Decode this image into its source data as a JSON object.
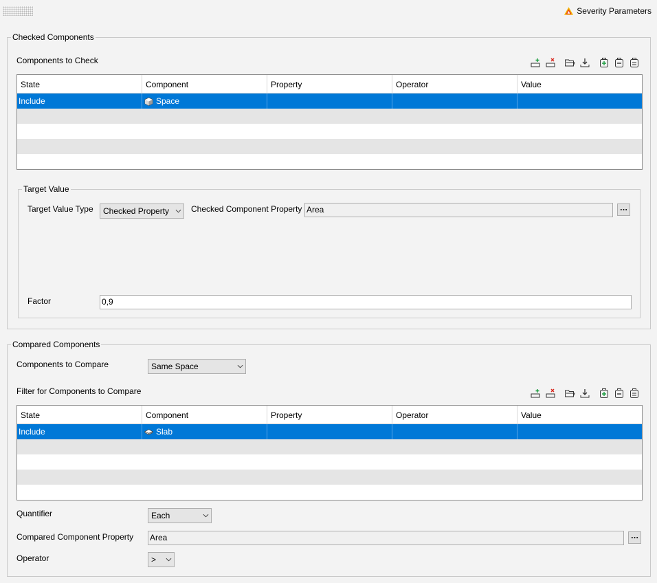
{
  "header": {
    "severity_label": "Severity Parameters",
    "severity_icon": "warning-triangle-icon",
    "severity_colors": [
      "#f4b400",
      "#e8431c"
    ]
  },
  "checked": {
    "legend": "Checked Components",
    "section_label": "Components to Check",
    "toolbar": [
      "add-row-icon",
      "remove-row-icon",
      "open-folder-icon",
      "download-icon",
      "add-item-icon",
      "remove-item-icon",
      "list-icon"
    ],
    "columns": [
      "State",
      "Component",
      "Property",
      "Operator",
      "Value"
    ],
    "rows": [
      {
        "state": "Include",
        "component": "Space",
        "property": "",
        "operator": "",
        "value": ""
      }
    ],
    "target": {
      "legend": "Target Value",
      "type_label": "Target Value Type",
      "type_value": "Checked Property",
      "prop_label": "Checked Component Property",
      "prop_value": "Area",
      "factor_label": "Factor",
      "factor_value": "0,9"
    }
  },
  "compared": {
    "legend": "Compared Components",
    "compare_label": "Components to Compare",
    "compare_value": "Same Space",
    "filter_label": "Filter for Components to Compare",
    "columns": [
      "State",
      "Component",
      "Property",
      "Operator",
      "Value"
    ],
    "rows": [
      {
        "state": "Include",
        "component": "Slab",
        "property": "",
        "operator": "",
        "value": ""
      }
    ],
    "quantifier_label": "Quantifier",
    "quantifier_value": "Each",
    "prop_label": "Compared Component Property",
    "prop_value": "Area",
    "operator_label": "Operator",
    "operator_value": ">"
  },
  "colors": {
    "selection": "#0078d7",
    "alt_row": "#e5e5e5",
    "background": "#f3f3f3"
  }
}
